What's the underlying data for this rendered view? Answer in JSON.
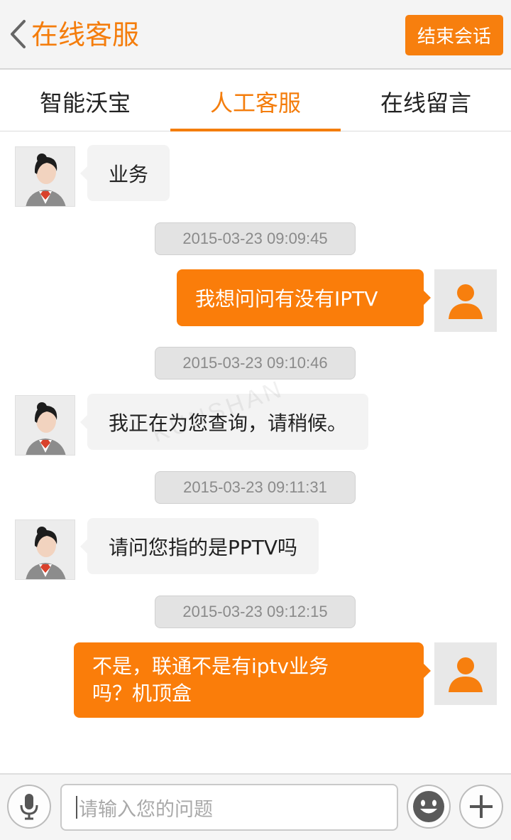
{
  "header": {
    "title": "在线客服",
    "end_button": "结束会话"
  },
  "tabs": [
    {
      "label": "智能沃宝",
      "active": false
    },
    {
      "label": "人工客服",
      "active": true
    },
    {
      "label": "在线留言",
      "active": false
    }
  ],
  "messages": [
    {
      "sender": "agent",
      "text": "业务"
    },
    {
      "type": "timestamp",
      "text": "2015-03-23 09:09:45"
    },
    {
      "sender": "user",
      "text": "我想问问有没有IPTV"
    },
    {
      "type": "timestamp",
      "text": "2015-03-23 09:10:46"
    },
    {
      "sender": "agent",
      "text": "我正在为您查询，请稍候。"
    },
    {
      "type": "timestamp",
      "text": "2015-03-23 09:11:31"
    },
    {
      "sender": "agent",
      "text": "请问您指的是PPTV吗"
    },
    {
      "type": "timestamp",
      "text": "2015-03-23 09:12:15"
    },
    {
      "sender": "user",
      "text_line1": "不是，联通不是有iptv业务",
      "text_line2": "吗？机顶盒"
    }
  ],
  "watermark": "KUNSHAN",
  "input": {
    "placeholder": "请输入您的问题"
  },
  "icons": {
    "back": "chevron-left-icon",
    "mic": "microphone-icon",
    "emoji": "emoji-icon",
    "plus": "plus-icon",
    "user": "user-avatar-icon"
  },
  "colors": {
    "accent": "#f47d0c",
    "user_bubble": "#fa7d0a",
    "agent_bubble": "#f3f3f3"
  }
}
